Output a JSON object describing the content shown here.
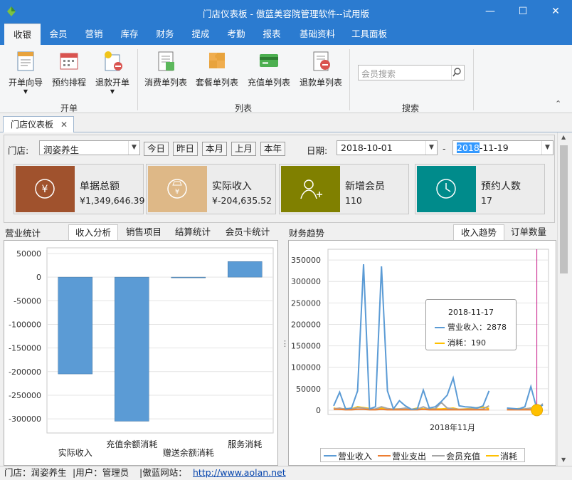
{
  "window": {
    "title": "门店仪表板 - 傲蓝美容院管理软件--试用版"
  },
  "menu_tabs": [
    "收银",
    "会员",
    "营销",
    "库存",
    "财务",
    "提成",
    "考勤",
    "报表",
    "基础资料",
    "工具面板"
  ],
  "ribbon": {
    "groups": [
      {
        "label": "开单",
        "buttons": [
          "开单向导",
          "预约排程",
          "退款开单"
        ]
      },
      {
        "label": "列表",
        "buttons": [
          "消费单列表",
          "套餐单列表",
          "充值单列表",
          "退款单列表"
        ]
      },
      {
        "label": "搜索"
      }
    ],
    "search_placeholder": "会员搜索"
  },
  "doc_tab": "门店仪表板",
  "filter": {
    "store_label": "门店:",
    "store_value": "润姿养生",
    "quick_buttons": [
      "今日",
      "昨日",
      "本月",
      "上月",
      "本年"
    ],
    "date_label": "日期:",
    "date_from": "2018-10-01",
    "date_sep": "-",
    "date_to_sel": "2018",
    "date_to_rest": "-11-19"
  },
  "cards": [
    {
      "name": "单据总额",
      "value": "¥1,349,646.39",
      "color": "#a0522d",
      "icon": "yen-circle-icon"
    },
    {
      "name": "实际收入",
      "value": "¥-204,635.52",
      "color": "#deb887",
      "icon": "money-bag-icon"
    },
    {
      "name": "新增会员",
      "value": "110",
      "color": "#808000",
      "icon": "add-user-icon"
    },
    {
      "name": "预约人数",
      "value": "17",
      "color": "#008b8b",
      "icon": "clock-icon"
    }
  ],
  "left_section": {
    "title": "营业统计",
    "tabs": [
      "收入分析",
      "销售项目",
      "结算统计",
      "会员卡统计"
    ]
  },
  "right_section": {
    "title": "财务趋势",
    "tabs": [
      "收入趋势",
      "订单数量"
    ]
  },
  "chart_data": [
    {
      "type": "bar",
      "categories": [
        "实际收入",
        "充值余额消耗",
        "赠送余额消耗",
        "服务消耗"
      ],
      "values": [
        -205000,
        -305000,
        -1000,
        33000
      ],
      "ylim": [
        -330000,
        62000
      ],
      "yticks": [
        50000,
        0,
        -50000,
        -100000,
        -150000,
        -200000,
        -250000,
        -300000
      ],
      "ytick_labels": [
        "50000",
        "0",
        "-50000",
        "-100000",
        "-150000",
        "-200000",
        "-250000",
        "-300000"
      ],
      "color": "#5b9bd5"
    },
    {
      "type": "line",
      "x_label": "2018年11月",
      "yticks": [
        0,
        50000,
        100000,
        150000,
        200000,
        250000,
        300000,
        350000
      ],
      "ytick_labels": [
        "0",
        "50000",
        "100000",
        "150000",
        "200000",
        "250000",
        "300000",
        "350000"
      ],
      "ylim": [
        -10000,
        375000
      ],
      "series": [
        {
          "name": "营业收入",
          "color": "#5b9bd5",
          "values": [
            10000,
            42000,
            3000,
            5000,
            45000,
            340000,
            3000,
            8000,
            335000,
            45000,
            3000,
            22000,
            10000,
            2000,
            3000,
            47000,
            5000,
            8000,
            20000,
            35000,
            75000,
            10000,
            8000,
            7000,
            5000,
            10000,
            45000,
            null,
            null,
            5000,
            4000,
            3000,
            8000,
            55000,
            2878,
            12000
          ]
        },
        {
          "name": "营业支出",
          "color": "#ed7d31",
          "values": [
            2000,
            2000,
            1000,
            1000,
            2000,
            2000,
            1000,
            1000,
            2000,
            1000,
            1000,
            1000,
            1000,
            1000,
            1000,
            2000,
            1000,
            1000,
            1000,
            1000,
            1000,
            1000,
            1000,
            1000,
            1000,
            1000,
            1000,
            null,
            null,
            1000,
            1000,
            1000,
            1000,
            1000,
            1000,
            1000
          ]
        },
        {
          "name": "会员充值",
          "color": "#a5a5a5",
          "values": [
            3000,
            5000,
            2000,
            2000,
            6000,
            5000,
            2000,
            3000,
            8000,
            4000,
            2000,
            3000,
            5000,
            2000,
            2000,
            8000,
            2000,
            3000,
            18000,
            5000,
            3000,
            2000,
            2000,
            3000,
            2000,
            3000,
            10000,
            null,
            null,
            2000,
            3000,
            2000,
            3000,
            5000,
            3000,
            15000
          ]
        },
        {
          "name": "消耗",
          "color": "#ffc000",
          "values": [
            5000,
            2000,
            4000,
            3000,
            8000,
            6000,
            4000,
            2000,
            5000,
            2000,
            3000,
            3000,
            4000,
            2000,
            5000,
            3000,
            4000,
            3000,
            3000,
            4000,
            5000,
            2000,
            3000,
            4000,
            6000,
            7000,
            4000,
            null,
            null,
            3000,
            2000,
            4000,
            3000,
            5000,
            190,
            2000
          ]
        }
      ]
    }
  ],
  "tooltip": {
    "date": "2018-11-17",
    "rows": [
      {
        "label": "营业收入：2878",
        "color": "#5b9bd5"
      },
      {
        "label": "消耗：190",
        "color": "#ffc000"
      }
    ]
  },
  "status": {
    "store": "门店：润姿养生",
    "user": "|用户：管理员",
    "site_label": "|傲蓝网站：",
    "site_url": "http://www.aolan.net"
  }
}
